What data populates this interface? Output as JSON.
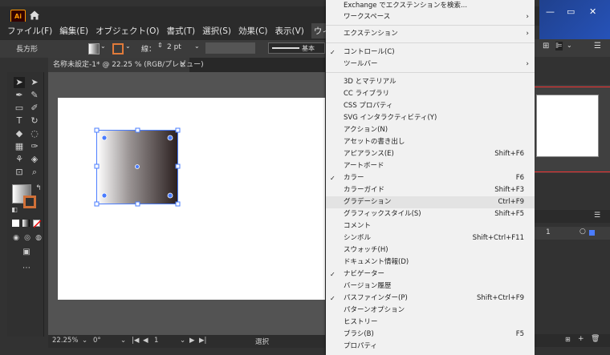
{
  "app": {
    "logo": "Ai",
    "doc_tab": "名称未設定-1* @ 22.25 % (RGB/プレビュー)",
    "doc_tab_close": "×"
  },
  "menubar": [
    "ファイル(F)",
    "編集(E)",
    "オブジェクト(O)",
    "書式(T)",
    "選択(S)",
    "効果(C)",
    "表示(V)",
    "ウィンドウ(W)"
  ],
  "control": {
    "object_type": "長方形",
    "stroke_label": "線：",
    "stroke_value": "2 pt",
    "stroke_profile": "基本"
  },
  "status": {
    "zoom": "22.25%",
    "rotation": "0°",
    "artboard": "1",
    "mode": "選択"
  },
  "right_panel": {
    "layer_number": "1"
  },
  "menu": {
    "items": [
      {
        "label": "Exchange でエクステンションを検索...",
        "shortcut": "",
        "checked": false,
        "submenu": false,
        "highlight": false
      },
      {
        "label": "ワークスペース",
        "shortcut": "",
        "checked": false,
        "submenu": true,
        "highlight": false
      },
      {
        "label": "エクステンション",
        "shortcut": "",
        "checked": false,
        "submenu": true,
        "highlight": false
      },
      {
        "label": "コントロール(C)",
        "shortcut": "",
        "checked": true,
        "submenu": false,
        "highlight": false
      },
      {
        "label": "ツールバー",
        "shortcut": "",
        "checked": false,
        "submenu": true,
        "highlight": false
      },
      {
        "label": "3D とマテリアル",
        "shortcut": "",
        "checked": false,
        "submenu": false,
        "highlight": false
      },
      {
        "label": "CC ライブラリ",
        "shortcut": "",
        "checked": false,
        "submenu": false,
        "highlight": false
      },
      {
        "label": "CSS プロパティ",
        "shortcut": "",
        "checked": false,
        "submenu": false,
        "highlight": false
      },
      {
        "label": "SVG インタラクティビティ(Y)",
        "shortcut": "",
        "checked": false,
        "submenu": false,
        "highlight": false
      },
      {
        "label": "アクション(N)",
        "shortcut": "",
        "checked": false,
        "submenu": false,
        "highlight": false
      },
      {
        "label": "アセットの書き出し",
        "shortcut": "",
        "checked": false,
        "submenu": false,
        "highlight": false
      },
      {
        "label": "アピアランス(E)",
        "shortcut": "Shift+F6",
        "checked": false,
        "submenu": false,
        "highlight": false
      },
      {
        "label": "アートボード",
        "shortcut": "",
        "checked": false,
        "submenu": false,
        "highlight": false
      },
      {
        "label": "カラー",
        "shortcut": "F6",
        "checked": true,
        "submenu": false,
        "highlight": false
      },
      {
        "label": "カラーガイド",
        "shortcut": "Shift+F3",
        "checked": false,
        "submenu": false,
        "highlight": false
      },
      {
        "label": "グラデーション",
        "shortcut": "Ctrl+F9",
        "checked": false,
        "submenu": false,
        "highlight": true
      },
      {
        "label": "グラフィックスタイル(S)",
        "shortcut": "Shift+F5",
        "checked": false,
        "submenu": false,
        "highlight": false
      },
      {
        "label": "コメント",
        "shortcut": "",
        "checked": false,
        "submenu": false,
        "highlight": false
      },
      {
        "label": "シンボル",
        "shortcut": "Shift+Ctrl+F11",
        "checked": false,
        "submenu": false,
        "highlight": false
      },
      {
        "label": "スウォッチ(H)",
        "shortcut": "",
        "checked": false,
        "submenu": false,
        "highlight": false
      },
      {
        "label": "ドキュメント情報(D)",
        "shortcut": "",
        "checked": false,
        "submenu": false,
        "highlight": false
      },
      {
        "label": "ナビゲーター",
        "shortcut": "",
        "checked": true,
        "submenu": false,
        "highlight": false
      },
      {
        "label": "バージョン履歴",
        "shortcut": "",
        "checked": false,
        "submenu": false,
        "highlight": false
      },
      {
        "label": "パスファインダー(P)",
        "shortcut": "Shift+Ctrl+F9",
        "checked": true,
        "submenu": false,
        "highlight": false
      },
      {
        "label": "パターンオプション",
        "shortcut": "",
        "checked": false,
        "submenu": false,
        "highlight": false
      },
      {
        "label": "ヒストリー",
        "shortcut": "",
        "checked": false,
        "submenu": false,
        "highlight": false
      },
      {
        "label": "ブラシ(B)",
        "shortcut": "F5",
        "checked": false,
        "submenu": false,
        "highlight": false
      },
      {
        "label": "プロパティ",
        "shortcut": "",
        "checked": false,
        "submenu": false,
        "highlight": false
      }
    ]
  },
  "colors": {
    "accent_selection": "#4a7cff",
    "menu_bg": "#f1f1f1",
    "app_bg": "#323232",
    "logo_orange": "#ff9a00"
  }
}
